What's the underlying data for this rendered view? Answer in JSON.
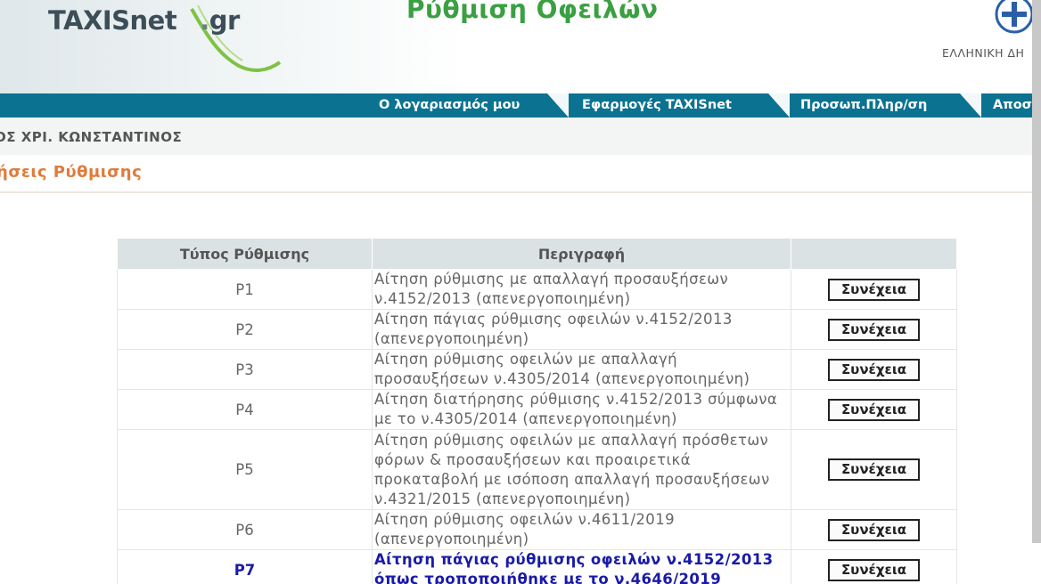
{
  "header": {
    "logo_main": "TAXISnet",
    "logo_dot": ".",
    "logo_suffix": "gr",
    "page_heading": "Ρύθμιση Οφειλών",
    "ministry_label": "ΕΛΛΗΝΙΚΗ ΔΗ"
  },
  "nav": {
    "items": [
      {
        "label": "Ο λογαριασμός μου"
      },
      {
        "label": "Εφαρμογές TAXISnet"
      },
      {
        "label": "Προσωπ.Πληρ/ση"
      },
      {
        "label": "Αποσ"
      }
    ],
    "color": "#0b7391"
  },
  "user": {
    "name": "ΟΣ ΧΡΙ. ΚΩΝΣΤΑΝΤΙΝΟΣ"
  },
  "section": {
    "title": "ήσεις Ρύθμισης",
    "color": "#e07b3a"
  },
  "table": {
    "headers": [
      "Τύπος Ρύθμισης",
      "Περιγραφή",
      ""
    ],
    "rows": [
      {
        "type": "P1",
        "lines": [
          "Αίτηση ρύθμισης με απαλλαγή προσαυξήσεων",
          "ν.4152/2013 (απενεργοποιημένη)"
        ],
        "action": "Συνέχεια"
      },
      {
        "type": "P2",
        "lines": [
          "Αίτηση πάγιας ρύθμισης οφειλών ν.4152/2013",
          "(απενεργοποιημένη)"
        ],
        "action": "Συνέχεια"
      },
      {
        "type": "P3",
        "lines": [
          "Αίτηση ρύθμισης οφειλών με απαλλαγή",
          "προσαυξήσεων ν.4305/2014 (απενεργοποιημένη)"
        ],
        "action": "Συνέχεια"
      },
      {
        "type": "P4",
        "lines": [
          "Αίτηση διατήρησης ρύθμισης ν.4152/2013 σύμφωνα",
          "με το ν.4305/2014 (απενεργοποιημένη)"
        ],
        "action": "Συνέχεια"
      },
      {
        "type": "P5",
        "lines": [
          "Αίτηση ρύθμισης οφειλών με απαλλαγή πρόσθετων",
          "φόρων & προσαυξήσεων και προαιρετικά",
          "προκαταβολή με ισόποση απαλλαγή προσαυξήσεων",
          "ν.4321/2015 (απενεργοποιημένη)"
        ],
        "action": "Συνέχεια"
      },
      {
        "type": "P6",
        "lines": [
          "Αίτηση ρύθμισης οφειλών ν.4611/2019",
          "(απενεργοποιημένη)"
        ],
        "action": "Συνέχεια"
      },
      {
        "type": "P7",
        "lines": [
          "Αίτηση πάγιας ρύθμισης οφειλών ν.4152/2013",
          "όπως τροποποιήθηκε με το ν.4646/2019"
        ],
        "action": "Συνέχεια",
        "highlight": true
      }
    ]
  }
}
